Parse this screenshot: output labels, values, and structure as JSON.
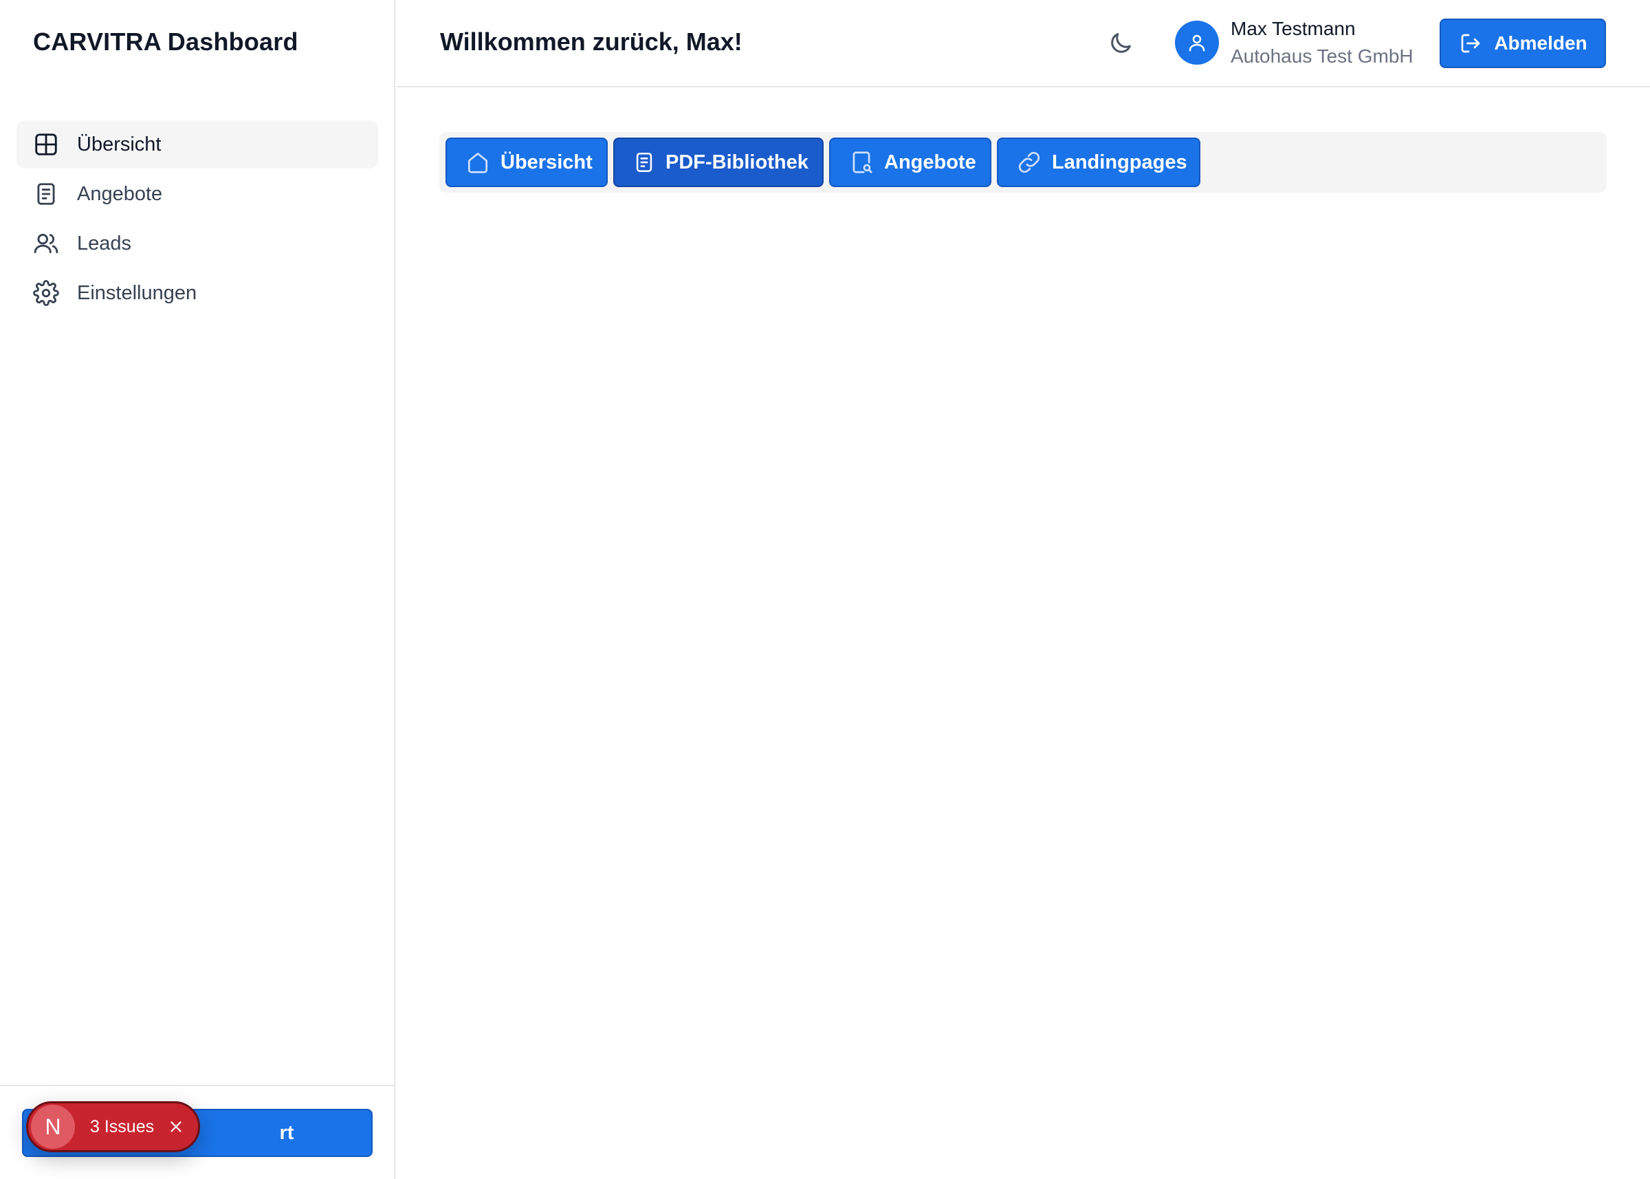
{
  "sidebar": {
    "brand": "CARVITRA Dashboard",
    "items": [
      {
        "label": "Übersicht",
        "icon": "grid-icon",
        "active": true
      },
      {
        "label": "Angebote",
        "icon": "document-icon",
        "active": false
      },
      {
        "label": "Leads",
        "icon": "users-icon",
        "active": false
      },
      {
        "label": "Einstellungen",
        "icon": "gear-icon",
        "active": false
      }
    ],
    "footer_button_label": "rt"
  },
  "header": {
    "welcome": "Willkommen zurück, Max!",
    "theme_icon": "moon-icon",
    "user": {
      "name": "Max Testmann",
      "company": "Autohaus Test GmbH",
      "avatar_icon": "user-icon"
    },
    "logout_label": "Abmelden",
    "logout_icon": "logout-icon"
  },
  "tabs": [
    {
      "label": "Übersicht",
      "icon": "home-icon",
      "active": false
    },
    {
      "label": "PDF-Bibliothek",
      "icon": "file-text-icon",
      "active": true
    },
    {
      "label": "Angebote",
      "icon": "file-search-icon",
      "active": false
    },
    {
      "label": "Landingpages",
      "icon": "link-icon",
      "active": false
    }
  ],
  "dev_overlay": {
    "badge_letter": "N",
    "issues_count": "3",
    "issues_label": "Issues"
  },
  "colors": {
    "accent": "#1a73e8",
    "accent_border": "#1558c0",
    "active_tab": "#1a5ccc",
    "issues_red": "#c8242f",
    "sidebar_active_bg": "#f5f5f6"
  }
}
